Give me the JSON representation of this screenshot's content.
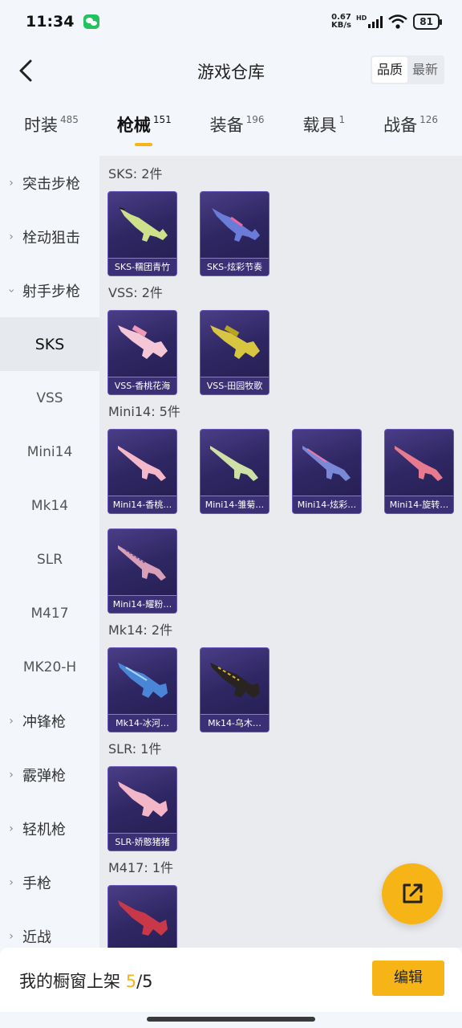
{
  "status": {
    "time": "11:34",
    "net_speed": "0.67",
    "net_unit": "KB/s",
    "hd": "HD",
    "battery": "81"
  },
  "header": {
    "title": "游戏仓库",
    "sort": [
      "品质",
      "最新"
    ]
  },
  "tabs": [
    {
      "label": "时装",
      "count": "485"
    },
    {
      "label": "枪械",
      "count": "151"
    },
    {
      "label": "装备",
      "count": "196"
    },
    {
      "label": "载具",
      "count": "1"
    },
    {
      "label": "战备",
      "count": "126"
    }
  ],
  "sidebar": [
    {
      "label": "突击步枪"
    },
    {
      "label": "栓动狙击"
    },
    {
      "label": "射手步枪"
    },
    {
      "label": "SKS"
    },
    {
      "label": "VSS"
    },
    {
      "label": "Mini14"
    },
    {
      "label": "Mk14"
    },
    {
      "label": "SLR"
    },
    {
      "label": "M417"
    },
    {
      "label": "MK20-H"
    },
    {
      "label": "冲锋枪"
    },
    {
      "label": "霰弹枪"
    },
    {
      "label": "轻机枪"
    },
    {
      "label": "手枪"
    },
    {
      "label": "近战"
    }
  ],
  "groups": [
    {
      "title": "SKS: 2件",
      "items": [
        "SKS-糯团青竹",
        "SKS-炫彩节奏"
      ]
    },
    {
      "title": "VSS: 2件",
      "items": [
        "VSS-香桃花海",
        "VSS-田园牧歌"
      ]
    },
    {
      "title": "Mini14: 5件",
      "items": [
        "Mini14-香桃…",
        "Mini14-雏菊…",
        "Mini14-炫彩…",
        "Mini14-旋转…",
        "Mini14-耀粉…"
      ]
    },
    {
      "title": "Mk14: 2件",
      "items": [
        "Mk14-冰河…",
        "Mk14-乌木…"
      ]
    },
    {
      "title": "SLR: 1件",
      "items": [
        "SLR-娇憨猪猪"
      ]
    },
    {
      "title": "M417: 1件",
      "items": [
        ""
      ]
    }
  ],
  "bottom": {
    "prefix": "我的橱窗上架 ",
    "current": "5",
    "total": "/5",
    "edit": "编辑"
  },
  "colors": {
    "accent": "#f6b416",
    "card_bg": "#2f2763"
  },
  "icons": {
    "back": "chevron-left-icon",
    "fab": "share-export-icon"
  }
}
